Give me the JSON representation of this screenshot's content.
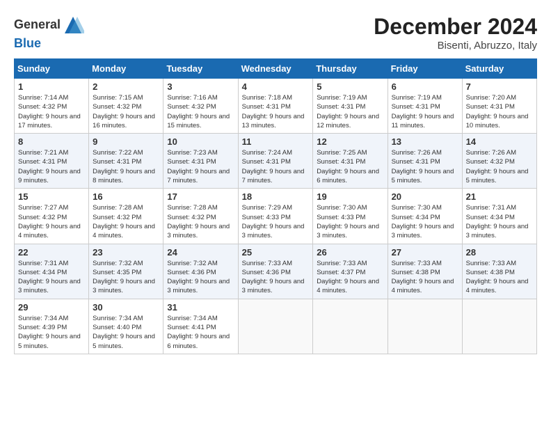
{
  "header": {
    "logo_line1": "General",
    "logo_line2": "Blue",
    "month": "December 2024",
    "location": "Bisenti, Abruzzo, Italy"
  },
  "weekdays": [
    "Sunday",
    "Monday",
    "Tuesday",
    "Wednesday",
    "Thursday",
    "Friday",
    "Saturday"
  ],
  "weeks": [
    [
      {
        "day": "1",
        "sunrise": "7:14 AM",
        "sunset": "4:32 PM",
        "daylight": "9 hours and 17 minutes."
      },
      {
        "day": "2",
        "sunrise": "7:15 AM",
        "sunset": "4:32 PM",
        "daylight": "9 hours and 16 minutes."
      },
      {
        "day": "3",
        "sunrise": "7:16 AM",
        "sunset": "4:32 PM",
        "daylight": "9 hours and 15 minutes."
      },
      {
        "day": "4",
        "sunrise": "7:18 AM",
        "sunset": "4:31 PM",
        "daylight": "9 hours and 13 minutes."
      },
      {
        "day": "5",
        "sunrise": "7:19 AM",
        "sunset": "4:31 PM",
        "daylight": "9 hours and 12 minutes."
      },
      {
        "day": "6",
        "sunrise": "7:19 AM",
        "sunset": "4:31 PM",
        "daylight": "9 hours and 11 minutes."
      },
      {
        "day": "7",
        "sunrise": "7:20 AM",
        "sunset": "4:31 PM",
        "daylight": "9 hours and 10 minutes."
      }
    ],
    [
      {
        "day": "8",
        "sunrise": "7:21 AM",
        "sunset": "4:31 PM",
        "daylight": "9 hours and 9 minutes."
      },
      {
        "day": "9",
        "sunrise": "7:22 AM",
        "sunset": "4:31 PM",
        "daylight": "9 hours and 8 minutes."
      },
      {
        "day": "10",
        "sunrise": "7:23 AM",
        "sunset": "4:31 PM",
        "daylight": "9 hours and 7 minutes."
      },
      {
        "day": "11",
        "sunrise": "7:24 AM",
        "sunset": "4:31 PM",
        "daylight": "9 hours and 7 minutes."
      },
      {
        "day": "12",
        "sunrise": "7:25 AM",
        "sunset": "4:31 PM",
        "daylight": "9 hours and 6 minutes."
      },
      {
        "day": "13",
        "sunrise": "7:26 AM",
        "sunset": "4:31 PM",
        "daylight": "9 hours and 5 minutes."
      },
      {
        "day": "14",
        "sunrise": "7:26 AM",
        "sunset": "4:32 PM",
        "daylight": "9 hours and 5 minutes."
      }
    ],
    [
      {
        "day": "15",
        "sunrise": "7:27 AM",
        "sunset": "4:32 PM",
        "daylight": "9 hours and 4 minutes."
      },
      {
        "day": "16",
        "sunrise": "7:28 AM",
        "sunset": "4:32 PM",
        "daylight": "9 hours and 4 minutes."
      },
      {
        "day": "17",
        "sunrise": "7:28 AM",
        "sunset": "4:32 PM",
        "daylight": "9 hours and 3 minutes."
      },
      {
        "day": "18",
        "sunrise": "7:29 AM",
        "sunset": "4:33 PM",
        "daylight": "9 hours and 3 minutes."
      },
      {
        "day": "19",
        "sunrise": "7:30 AM",
        "sunset": "4:33 PM",
        "daylight": "9 hours and 3 minutes."
      },
      {
        "day": "20",
        "sunrise": "7:30 AM",
        "sunset": "4:34 PM",
        "daylight": "9 hours and 3 minutes."
      },
      {
        "day": "21",
        "sunrise": "7:31 AM",
        "sunset": "4:34 PM",
        "daylight": "9 hours and 3 minutes."
      }
    ],
    [
      {
        "day": "22",
        "sunrise": "7:31 AM",
        "sunset": "4:34 PM",
        "daylight": "9 hours and 3 minutes."
      },
      {
        "day": "23",
        "sunrise": "7:32 AM",
        "sunset": "4:35 PM",
        "daylight": "9 hours and 3 minutes."
      },
      {
        "day": "24",
        "sunrise": "7:32 AM",
        "sunset": "4:36 PM",
        "daylight": "9 hours and 3 minutes."
      },
      {
        "day": "25",
        "sunrise": "7:33 AM",
        "sunset": "4:36 PM",
        "daylight": "9 hours and 3 minutes."
      },
      {
        "day": "26",
        "sunrise": "7:33 AM",
        "sunset": "4:37 PM",
        "daylight": "9 hours and 4 minutes."
      },
      {
        "day": "27",
        "sunrise": "7:33 AM",
        "sunset": "4:38 PM",
        "daylight": "9 hours and 4 minutes."
      },
      {
        "day": "28",
        "sunrise": "7:33 AM",
        "sunset": "4:38 PM",
        "daylight": "9 hours and 4 minutes."
      }
    ],
    [
      {
        "day": "29",
        "sunrise": "7:34 AM",
        "sunset": "4:39 PM",
        "daylight": "9 hours and 5 minutes."
      },
      {
        "day": "30",
        "sunrise": "7:34 AM",
        "sunset": "4:40 PM",
        "daylight": "9 hours and 5 minutes."
      },
      {
        "day": "31",
        "sunrise": "7:34 AM",
        "sunset": "4:41 PM",
        "daylight": "9 hours and 6 minutes."
      },
      null,
      null,
      null,
      null
    ]
  ]
}
